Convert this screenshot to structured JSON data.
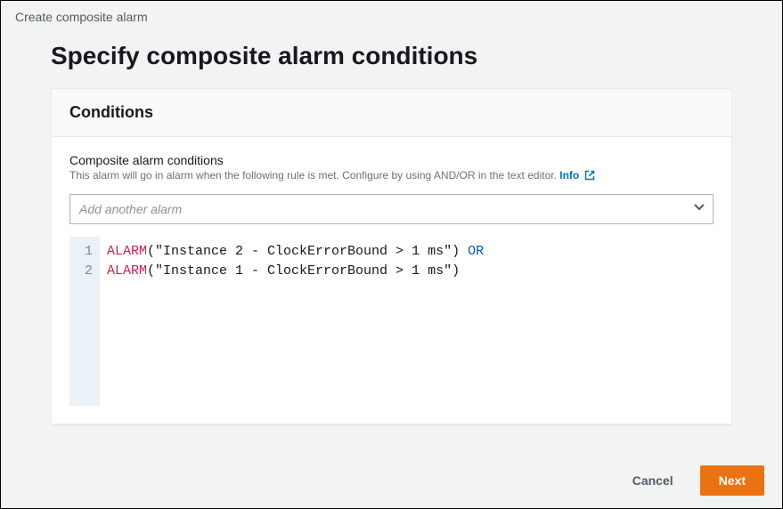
{
  "breadcrumb": "Create composite alarm",
  "page_title": "Specify composite alarm conditions",
  "panel": {
    "header": "Conditions",
    "field_label": "Composite alarm conditions",
    "field_desc": "This alarm will go in alarm when the following rule is met. Configure by using AND/OR in the text editor.",
    "info_label": "Info",
    "select_placeholder": "Add another alarm",
    "code": {
      "lines": [
        {
          "n": "1",
          "kw": "ALARM",
          "str": "(\"Instance 2 - ClockErrorBound > 1 ms\")",
          "op": " OR"
        },
        {
          "n": "2",
          "kw": "ALARM",
          "str": "(\"Instance 1 - ClockErrorBound > 1 ms\")",
          "op": ""
        }
      ]
    }
  },
  "footer": {
    "cancel": "Cancel",
    "next": "Next"
  }
}
